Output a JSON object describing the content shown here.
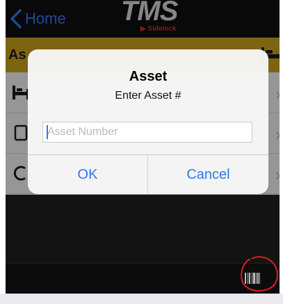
{
  "nav": {
    "back_label": "Home"
  },
  "logo": {
    "title": "TMS",
    "subtitle": "Sidelock"
  },
  "titlebar": {
    "title": "As"
  },
  "alert": {
    "title": "Asset",
    "message": "Enter Asset #",
    "input_placeholder": "Asset Number",
    "ok_label": "OK",
    "cancel_label": "Cancel"
  },
  "icons": {
    "back": "chevron-left-icon",
    "bed": "bed-icon",
    "barcode": "barcode-icon",
    "row_arrow": "chevron-right-icon"
  },
  "colors": {
    "accent": "#2f78f0",
    "titlebar": "#caa21a",
    "annotation": "#d8201f"
  }
}
